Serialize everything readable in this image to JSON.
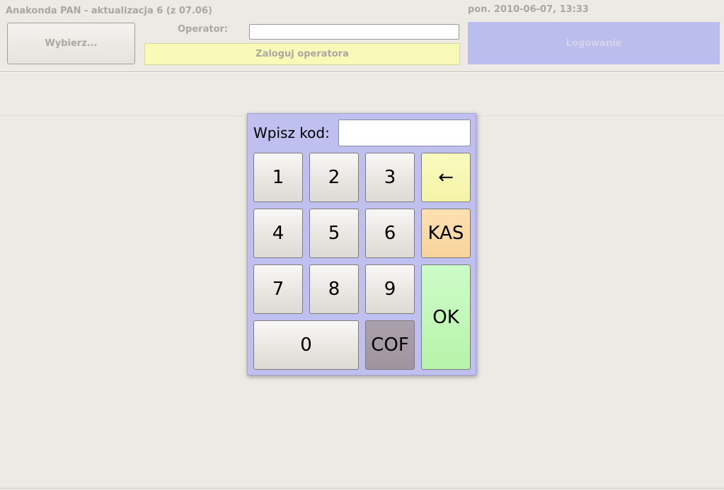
{
  "app": {
    "title": "Anakonda PAN - aktualizacja 6 (z 07.06)",
    "datetime": "pon. 2010-06-07, 13:33"
  },
  "header": {
    "select_label": "Wybierz...",
    "operator_label": "Operator:",
    "operator_value": "",
    "login_operator_label": "Zaloguj operatora",
    "login_label": "Logowanie"
  },
  "keypad": {
    "prompt": "Wpisz kod:",
    "code_value": "",
    "keys": {
      "k1": "1",
      "k2": "2",
      "k3": "3",
      "k4": "4",
      "k5": "5",
      "k6": "6",
      "k7": "7",
      "k8": "8",
      "k9": "9",
      "k0": "0",
      "backspace": "←",
      "kas": "KAS",
      "ok": "OK",
      "cof": "COF"
    }
  },
  "colors": {
    "background": "#ede9e5",
    "dialog": "#bfbff0",
    "login_button": "#bcbdef",
    "login_operator_button": "#fafab8",
    "backspace_key": "#f4f4a8",
    "kas_key": "#f8d49a",
    "ok_key": "#b7f3a9",
    "cof_key": "#a49aa5",
    "disabled_text": "#aaa6a1"
  },
  "icons": {
    "backspace": "left-arrow-icon"
  }
}
